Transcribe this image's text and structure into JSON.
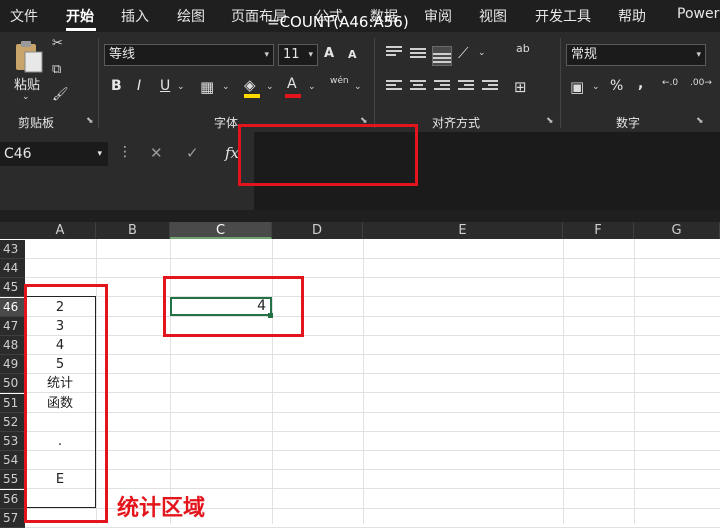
{
  "menu": {
    "tabs": [
      "文件",
      "开始",
      "插入",
      "绘图",
      "页面布局",
      "公式",
      "数据",
      "审阅",
      "视图",
      "开发工具",
      "帮助",
      "Power"
    ],
    "active": "开始"
  },
  "ribbon": {
    "clipboard": {
      "paste_label": "粘贴",
      "group_label": "剪贴板"
    },
    "font": {
      "font_name": "等线",
      "font_size": "11",
      "group_label": "字体",
      "bold": "B",
      "italic": "I",
      "underline": "U",
      "grow": "A",
      "shrink": "A",
      "font_color_label": "A",
      "phonetic": "wén"
    },
    "alignment": {
      "group_label": "对齐方式",
      "wrap_icon": "ab"
    },
    "number": {
      "format": "常规",
      "group_label": "数字",
      "percent": "%",
      "comma": ","
    },
    "colors": {
      "font_color_bar": "#e3141b",
      "fill_color_bar": "#ffd800"
    }
  },
  "formula_bar": {
    "name_box": "C46",
    "cancel": "✕",
    "enter": "✓",
    "fx": "fx",
    "formula": "=COUNT(A46:A56)"
  },
  "sheet": {
    "columns": [
      "A",
      "B",
      "C",
      "D",
      "E",
      "F",
      "G"
    ],
    "selected_column": "C",
    "rows": [
      "43",
      "44",
      "45",
      "46",
      "47",
      "48",
      "49",
      "50",
      "51",
      "52",
      "53",
      "54",
      "55",
      "56",
      "57"
    ],
    "selected_row": "46",
    "colA_values": [
      "",
      "",
      "",
      "2",
      "3",
      "4",
      "5",
      "统计",
      "函数",
      "",
      ".",
      "",
      "E",
      "",
      ""
    ],
    "c46_value": "4"
  },
  "annotation": {
    "label": "统计区域",
    "color": "#e3141b"
  }
}
